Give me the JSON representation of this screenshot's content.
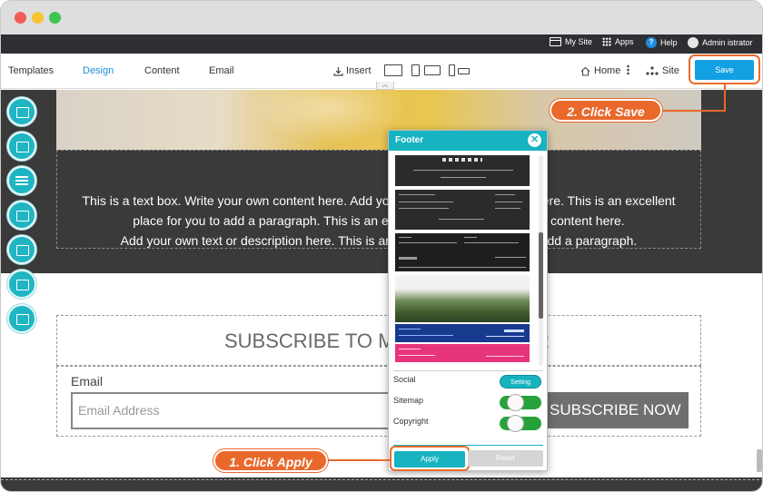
{
  "topbar": {
    "my_site": "My Site",
    "apps": "Apps",
    "help": "Help",
    "help_glyph": "?",
    "user": "Admin istrator"
  },
  "toolbar": {
    "tabs": [
      "Templates",
      "Design",
      "Content",
      "Email"
    ],
    "active_tab": "Design",
    "insert": "Insert",
    "home": "Home",
    "site": "Site",
    "save": "Save"
  },
  "canvas": {
    "text_lines": [
      "This is a text box. Write your own content here. Add your own text or description here. This is an excellent",
      "place for you to add a paragraph. This is an excellent place for you to add content here.",
      "Add your own text or description here. This is an excellent place for you to add a paragraph."
    ],
    "subscribe_heading": "SUBSCRIBE TO MY NEWSLETTER",
    "email_label": "Email",
    "email_placeholder": "Email Address",
    "subscribe_button": "SUBSCRIBE NOW"
  },
  "panel": {
    "title": "Footer",
    "close_glyph": "✕",
    "options": [
      {
        "label": "Social",
        "control": "Setting"
      },
      {
        "label": "Sitemap",
        "control": "On"
      },
      {
        "label": "Copyright",
        "control": "On"
      }
    ],
    "apply": "Apply",
    "reset": "Reset"
  },
  "callouts": {
    "click_save": "2. Click Save",
    "click_apply": "1. Click Apply"
  },
  "colors": {
    "accent": "#17b3c1",
    "save_blue": "#12a0e3",
    "callout_orange": "#e9682b",
    "toggle_green": "#27a23b"
  }
}
